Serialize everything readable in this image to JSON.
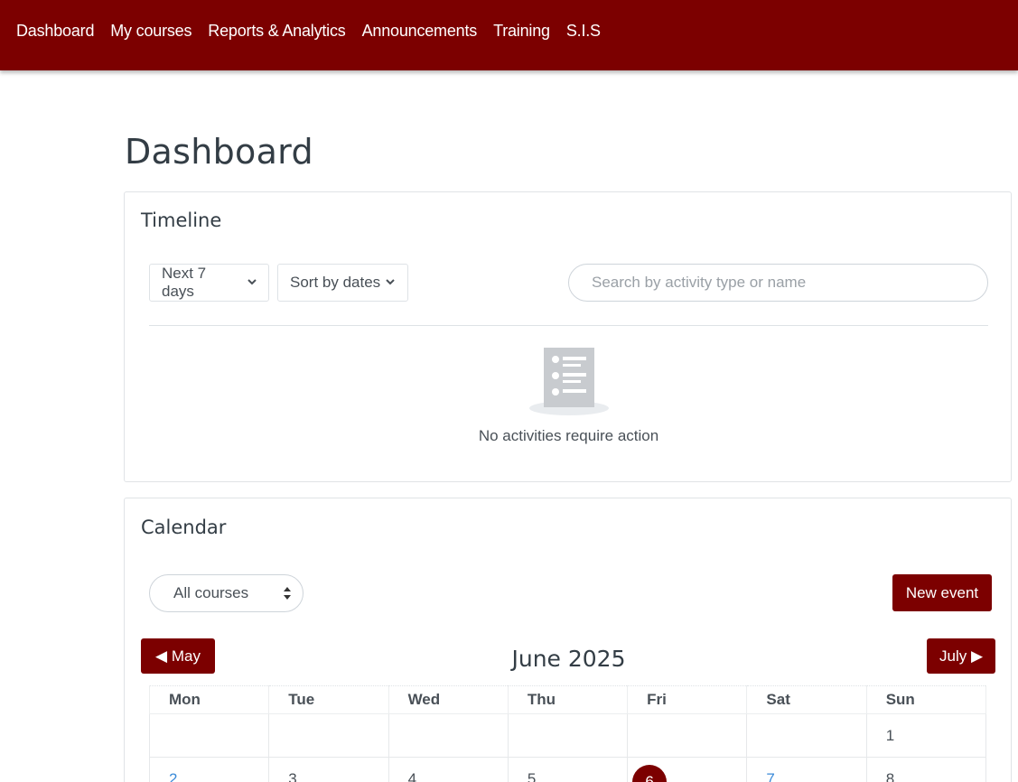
{
  "nav": {
    "items": [
      "Dashboard",
      "My courses",
      "Reports & Analytics",
      "Announcements",
      "Training",
      "S.I.S"
    ]
  },
  "page": {
    "title": "Dashboard"
  },
  "timeline": {
    "title": "Timeline",
    "range_filter": "Next 7 days",
    "sort_filter": "Sort by dates",
    "search_placeholder": "Search by activity type or name",
    "empty_message": "No activities require action",
    "empty_icon": "checklist-icon"
  },
  "calendar": {
    "title": "Calendar",
    "course_select": "All courses",
    "new_event_label": "New event",
    "prev_month_label": "◀ May",
    "next_month_label": "July ▶",
    "month_title": "June 2025",
    "weekdays": [
      "Mon",
      "Tue",
      "Wed",
      "Thu",
      "Fri",
      "Sat",
      "Sun"
    ],
    "rows": [
      [
        "",
        "",
        "",
        "",
        "",
        "",
        "1"
      ],
      [
        "2",
        "3",
        "4",
        "5",
        "6",
        "7",
        "8"
      ]
    ],
    "today": "6",
    "linked_days": [
      "2",
      "7"
    ]
  },
  "colors": {
    "brand": "#7c0000",
    "link": "#3b8bd9"
  }
}
